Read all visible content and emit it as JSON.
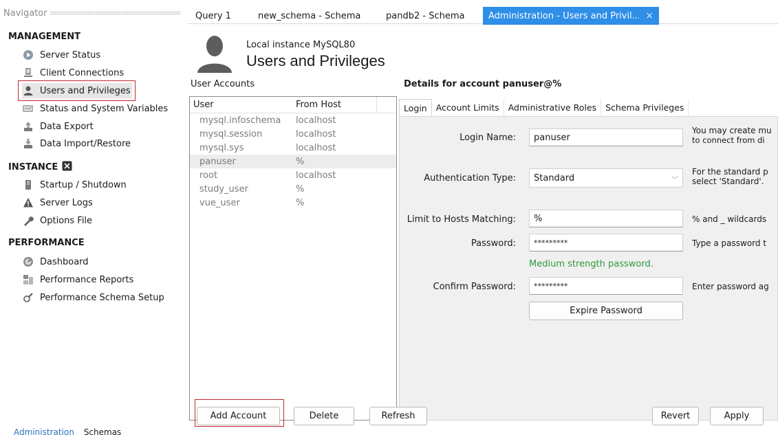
{
  "navigator": {
    "header": "Navigator",
    "sections": {
      "management": "MANAGEMENT",
      "instance": "INSTANCE",
      "performance": "PERFORMANCE"
    },
    "management_items": [
      "Server Status",
      "Client Connections",
      "Users and Privileges",
      "Status and System Variables",
      "Data Export",
      "Data Import/Restore"
    ],
    "instance_items": [
      "Startup / Shutdown",
      "Server Logs",
      "Options File"
    ],
    "performance_items": [
      "Dashboard",
      "Performance Reports",
      "Performance Schema Setup"
    ],
    "bottom_tabs": [
      "Administration",
      "Schemas"
    ]
  },
  "tabs": [
    "Query 1",
    "new_schema - Schema",
    "pandb2 - Schema",
    "Administration - Users and Privil..."
  ],
  "header": {
    "instance": "Local instance MySQL80",
    "title": "Users and Privileges"
  },
  "accounts": {
    "label": "User Accounts",
    "columns": [
      "User",
      "From Host"
    ],
    "rows": [
      {
        "user": "mysql.infoschema",
        "host": "localhost"
      },
      {
        "user": "mysql.session",
        "host": "localhost"
      },
      {
        "user": "mysql.sys",
        "host": "localhost"
      },
      {
        "user": "panuser",
        "host": "%"
      },
      {
        "user": "root",
        "host": "localhost"
      },
      {
        "user": "study_user",
        "host": "%"
      },
      {
        "user": "vue_user",
        "host": "%"
      }
    ],
    "selected_user": "panuser"
  },
  "details": {
    "title": "Details for account panuser@%",
    "tabs": [
      "Login",
      "Account Limits",
      "Administrative Roles",
      "Schema Privileges"
    ],
    "login_name_label": "Login Name:",
    "login_name": "panuser",
    "login_hint_1": "You may create mu",
    "login_hint_2": "to connect from di",
    "auth_type_label": "Authentication Type:",
    "auth_type": "Standard",
    "auth_hint_1": "For the standard p",
    "auth_hint_2": "select 'Standard'.",
    "limit_hosts_label": "Limit to Hosts Matching:",
    "limit_hosts": "%",
    "limit_hint": "% and _ wildcards",
    "password_label": "Password:",
    "password": "*********",
    "password_hint": "Type a password t",
    "strength": "Medium strength password.",
    "confirm_label": "Confirm Password:",
    "confirm": "*********",
    "confirm_hint": "Enter password ag",
    "expire_button": "Expire Password"
  },
  "buttons": {
    "add_account": "Add Account",
    "delete": "Delete",
    "refresh": "Refresh",
    "revert": "Revert",
    "apply": "Apply"
  },
  "colors": {
    "active_tab": "#2e8ee8",
    "highlight_box": "#c0272d",
    "strength": "#2f9a3c"
  }
}
